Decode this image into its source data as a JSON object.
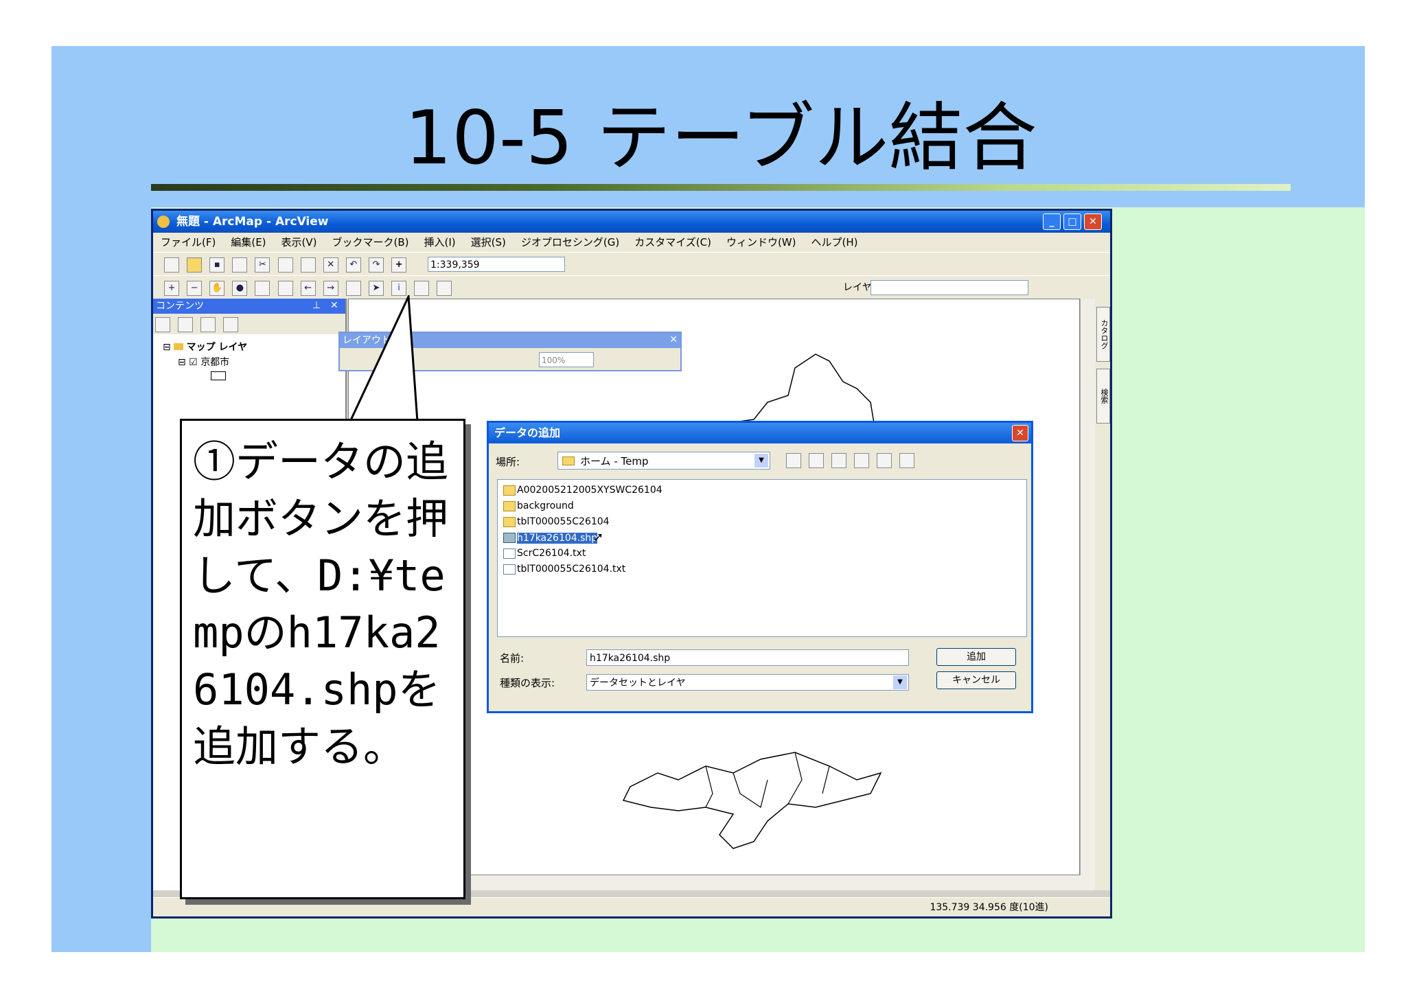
{
  "slide": {
    "title": "10-5 テーブル結合",
    "callout": "①データの追加ボタンを押して、D:¥tempのh17ka26104.shpを追加する。"
  },
  "window": {
    "title": "無題 - ArcMap - ArcView",
    "menu": [
      "ファイル(F)",
      "編集(E)",
      "表示(V)",
      "ブックマーク(B)",
      "挿入(I)",
      "選択(S)",
      "ジオプロセシング(G)",
      "カスタマイズ(C)",
      "ウィンドウ(W)",
      "ヘルプ(H)"
    ],
    "scale": "1:339,359",
    "layer_label": "レイヤ:",
    "toc": {
      "header": "コンテンツ",
      "root": "マップ レイヤ",
      "layer": "京都市"
    },
    "layout_toolbar": {
      "title": "レイアウト",
      "zoom": "100%"
    },
    "side_tabs": [
      "カタログ",
      "検索"
    ],
    "status": {
      "x": "135.739",
      "y": "34.956",
      "units": "度(10進)"
    }
  },
  "dialog": {
    "title": "データの追加",
    "location_label": "場所:",
    "location": "ホーム - Temp",
    "items": [
      {
        "name": "A002005212005XYSWC26104",
        "type": "folder"
      },
      {
        "name": "background",
        "type": "folder"
      },
      {
        "name": "tblT000055C26104",
        "type": "folder"
      },
      {
        "name": "h17ka26104.shp",
        "type": "shp",
        "selected": true
      },
      {
        "name": "ScrC26104.txt",
        "type": "doc"
      },
      {
        "name": "tblT000055C26104.txt",
        "type": "doc"
      }
    ],
    "name_label": "名前:",
    "name_value": "h17ka26104.shp",
    "type_label": "種類の表示:",
    "type_value": "データセットとレイヤ",
    "add_button": "追加",
    "cancel_button": "キャンセル"
  },
  "colors": {
    "slide_blue": "#99c9f9",
    "slide_green": "#d4f9d4",
    "xp_blue": "#0b5bd6",
    "selection": "#316ac5"
  }
}
